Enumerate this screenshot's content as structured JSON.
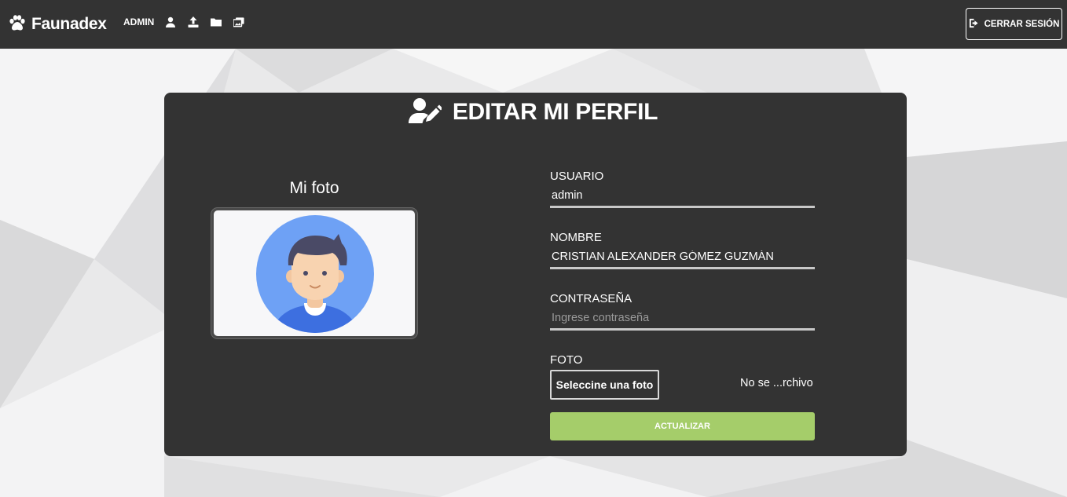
{
  "navbar": {
    "brand_name": "Faunadex",
    "user_label": "ADMIN",
    "icons": [
      "user-icon",
      "upload-icon",
      "folder-icon",
      "gallery-icon"
    ],
    "logout_label": "CERRAR SESIÓN"
  },
  "card": {
    "title": "EDITAR MI PERFIL",
    "photo_label": "Mi foto",
    "fields": {
      "usuario_label": "USUARIO",
      "usuario_value": "admin",
      "nombre_label": "NOMBRE",
      "nombre_value": "CRISTIAN ALEXANDER GÓMEZ GUZMÁN",
      "password_label": "CONTRASEÑA",
      "password_placeholder": "Ingrese contraseña",
      "foto_label": "FOTO",
      "file_button_label": "Seleccine una foto",
      "file_status": "No se ...rchivo"
    },
    "submit_label": "ACTUALIZAR"
  },
  "colors": {
    "navbar_bg": "#333333",
    "card_bg": "#333333",
    "submit_bg": "#a5cd6a",
    "avatar_bg": "#6ea1f5"
  }
}
